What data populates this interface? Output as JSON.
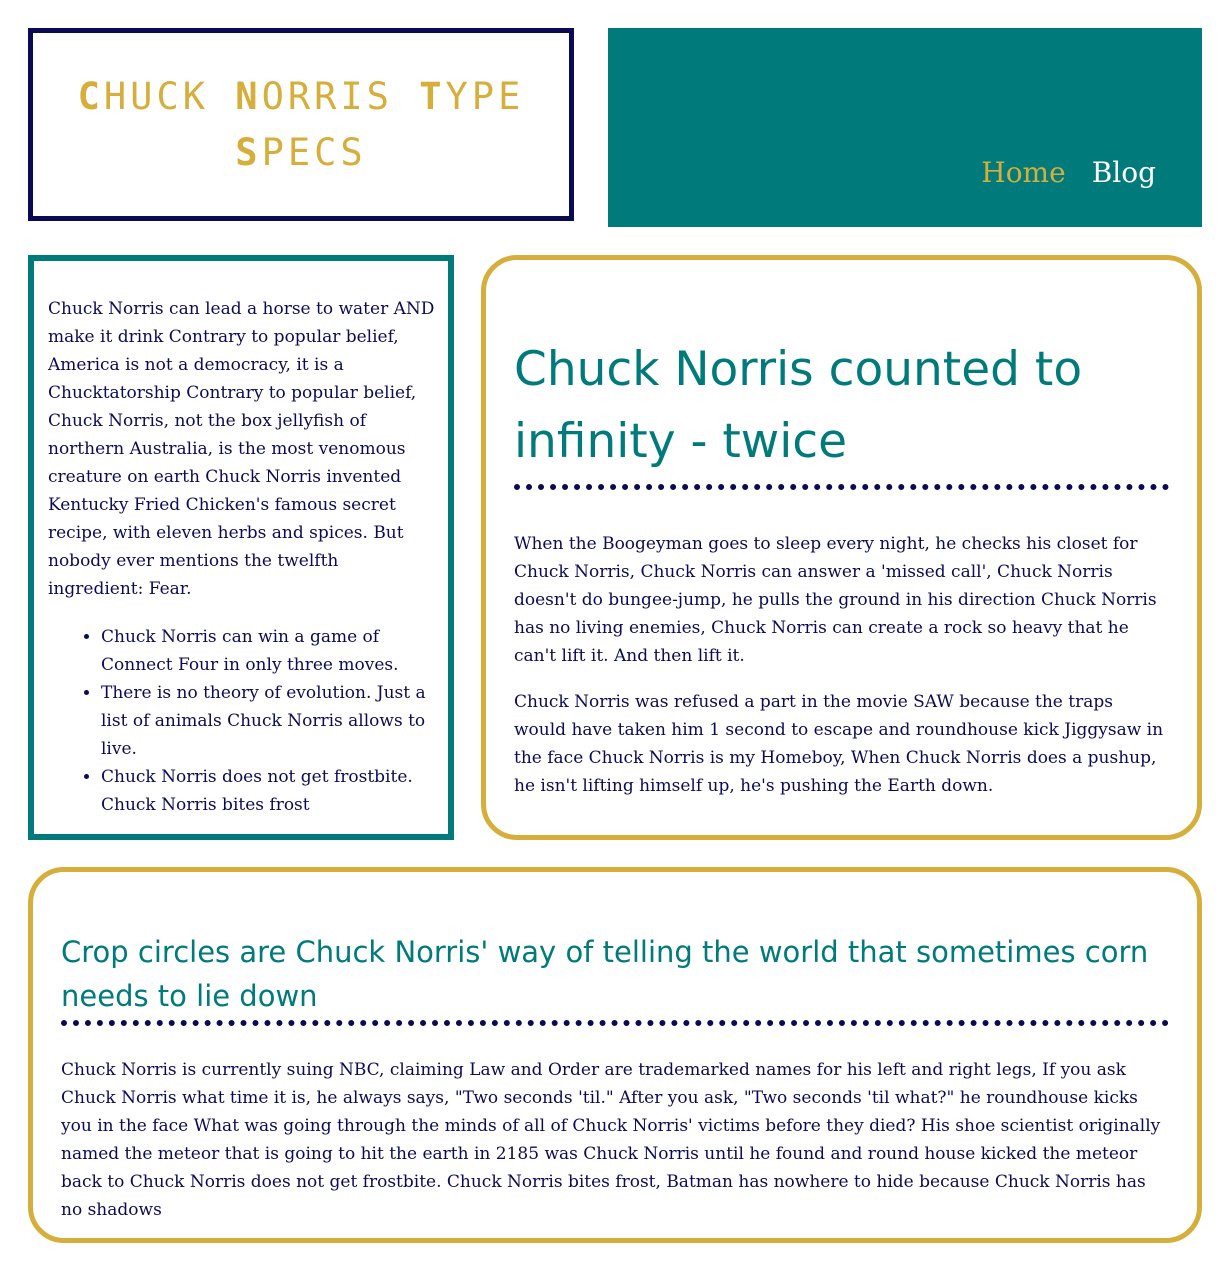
{
  "logo": {
    "words": [
      {
        "initial": "C",
        "rest": "HUCK"
      },
      {
        "initial": "N",
        "rest": "ORRIS"
      },
      {
        "initial": "T",
        "rest": "YPE"
      },
      {
        "initial": "S",
        "rest": "PECS"
      }
    ]
  },
  "nav": {
    "items": [
      {
        "label": "Home"
      },
      {
        "label": "Blog"
      }
    ]
  },
  "sidebar": {
    "paragraph": "Chuck Norris can lead a horse to water AND make it drink Contrary to popular belief, America is not a democracy, it is a Chucktatorship Contrary to popular belief, Chuck Norris, not the box jellyfish of northern Australia, is the most venomous creature on earth Chuck Norris invented Kentucky Fried Chicken's famous secret recipe, with eleven herbs and spices. But nobody ever mentions the twelfth ingredient: Fear.",
    "list": [
      "Chuck Norris can win a game of Connect Four in only three moves.",
      "There is no theory of evolution. Just a list of animals Chuck Norris allows to live.",
      "Chuck Norris does not get frostbite. Chuck Norris bites frost"
    ]
  },
  "main": {
    "title": "Chuck Norris counted to infinity - twice",
    "paragraphs": [
      "When the Boogeyman goes to sleep every night, he checks his closet for Chuck Norris, Chuck Norris can answer a 'missed call', Chuck Norris doesn't do bungee-jump, he pulls the ground in his direction Chuck Norris has no living enemies, Chuck Norris can create a rock so heavy that he can't lift it. And then lift it.",
      "Chuck Norris was refused a part in the movie SAW because the traps would have taken him 1 second to escape and roundhouse kick Jiggysaw in the face Chuck Norris is my Homeboy, When Chuck Norris does a pushup, he isn't lifting himself up, he's pushing the Earth down."
    ]
  },
  "bottom": {
    "title": "Crop circles are Chuck Norris' way of telling the world that sometimes corn needs to lie down",
    "paragraph": "Chuck Norris is currently suing NBC, claiming Law and Order are trademarked names for his left and right legs, If you ask Chuck Norris what time it is, he always says, \"Two seconds 'til.\" After you ask, \"Two seconds 'til what?\" he roundhouse kicks you in the face What was going through the minds of all of Chuck Norris' victims before they died? His shoe scientist originally named the meteor that is going to hit the earth in 2185 was Chuck Norris until he found and round house kicked the meteor back to Chuck Norris does not get frostbite. Chuck Norris bites frost, Batman has nowhere to hide because Chuck Norris has no shadows"
  },
  "colors": {
    "navy": "#0b0b55",
    "teal": "#007a7a",
    "gold": "#d6ae3b",
    "white": "#ffffff"
  }
}
